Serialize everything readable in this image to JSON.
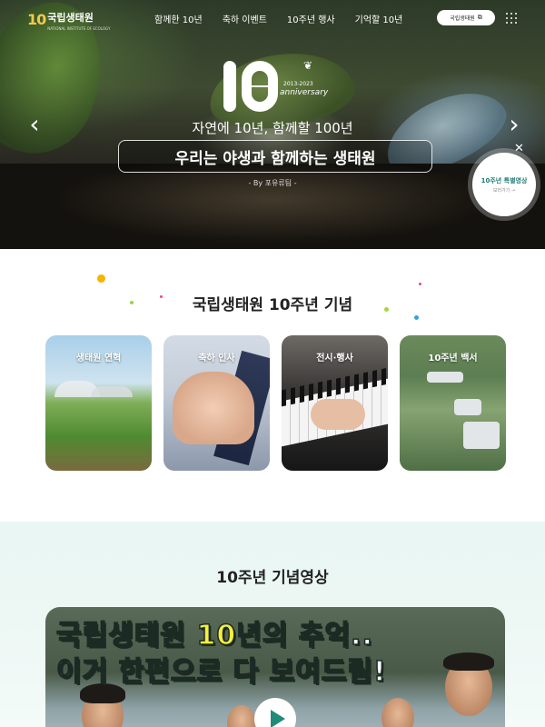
{
  "header": {
    "logo_mark": "10",
    "logo_name": "국립생태원",
    "logo_subtitle": "NATIONAL INSTITUTE OF ECOLOGY",
    "menu": [
      "함께한 10년",
      "축하 이벤트",
      "10주년 행사",
      "기억할 10년"
    ],
    "site_button": "국립생태원",
    "site_button_icon": "external-link-icon",
    "menu_icon": "grid-menu-icon"
  },
  "hero": {
    "big_number": "10",
    "years": "2013-2023",
    "anniversary": "anniversary",
    "subtitle": "자연에 10년, 함께할 100년",
    "headline": "우리는 야생과 함께하는 생태원",
    "credit": "- By 포유류팀 -",
    "prev_icon": "chevron-left-icon",
    "next_icon": "chevron-right-icon",
    "close_icon": "close-icon",
    "badge_title": "10주년 특별영상",
    "badge_sub": "보러가기 →"
  },
  "section1": {
    "title": "국립생태원 10주년 기념",
    "cards": [
      {
        "label": "생태원 연혁"
      },
      {
        "label": "축하 인사"
      },
      {
        "label": "전시·행사"
      },
      {
        "label": "10주년 백서"
      }
    ]
  },
  "section2": {
    "title": "10주년 기념영상",
    "video_line1_a": "국립생태원 ",
    "video_line1_hl": "10년",
    "video_line1_b": "의 추억..",
    "video_line2": "이거 한편으로 다 보여드림!",
    "play_icon": "play-icon"
  },
  "colors": {
    "accent_teal": "#1f8c7a",
    "highlight_yellow": "#f7ef3e",
    "logo_yellow": "#f2c94c",
    "logo_pink": "#e84a7c"
  }
}
